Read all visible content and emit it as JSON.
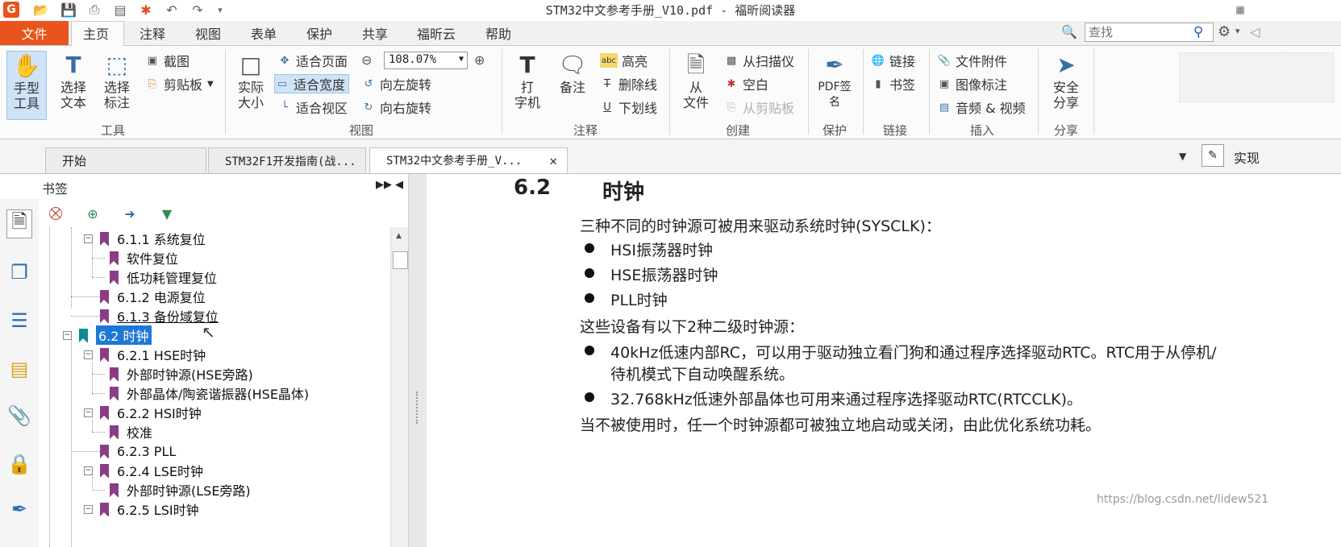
{
  "window": {
    "title": "STM32中文参考手册_V10.pdf - 福昕阅读器"
  },
  "menu": {
    "file": "文件",
    "tabs": [
      "主页",
      "注释",
      "视图",
      "表单",
      "保护",
      "共享",
      "福昕云",
      "帮助"
    ],
    "search_placeholder": "查找"
  },
  "ribbon": {
    "tools": {
      "label": "工具",
      "hand": "手型\n工具",
      "select_text": "选择\n文本",
      "select_annot": "选择\n标注",
      "snapshot": "截图",
      "clipboard": "剪贴板"
    },
    "view": {
      "label": "视图",
      "actual_size": "实际\n大小",
      "fit_page": "适合页面",
      "fit_width": "适合宽度",
      "fit_visible": "适合视区",
      "zoom": "108.07%",
      "rotate_left": "向左旋转",
      "rotate_right": "向右旋转"
    },
    "annotate": {
      "label": "注释",
      "typewriter": "打\n字机",
      "note": "备注",
      "highlight": "高亮",
      "strikeout": "删除线",
      "underline": "下划线"
    },
    "create": {
      "label": "创建",
      "from_file": "从\n文件",
      "from_scanner": "从扫描仪",
      "blank": "空白",
      "from_clipboard": "从剪贴板"
    },
    "protect": {
      "label": "保护",
      "pdf_sign": "PDF签\n名"
    },
    "links": {
      "label": "链接",
      "link": "链接",
      "bookmark": "书签"
    },
    "insert": {
      "label": "插入",
      "file_attachment": "文件附件",
      "image_annotation": "图像标注",
      "audio_video": "音频 & 视频"
    },
    "share": {
      "label": "分享",
      "secure_share": "安全\n分享"
    }
  },
  "doc_tabs": {
    "tabs": [
      "开始",
      "STM32F1开发指南(战...",
      "STM32中文参考手册_V..."
    ],
    "right_action": "实现"
  },
  "bookmarks": {
    "title": "书签",
    "tree": [
      {
        "text": "6.1.1 系统复位"
      },
      {
        "text": "软件复位"
      },
      {
        "text": "低功耗管理复位"
      },
      {
        "text": "6.1.2 电源复位"
      },
      {
        "text": "6.1.3 备份域复位"
      },
      {
        "text": "6.2 时钟"
      },
      {
        "text": "6.2.1 HSE时钟"
      },
      {
        "text": "外部时钟源(HSE旁路)"
      },
      {
        "text": "外部晶体/陶瓷谐振器(HSE晶体)"
      },
      {
        "text": "6.2.2 HSI时钟"
      },
      {
        "text": "校准"
      },
      {
        "text": "6.2.3 PLL"
      },
      {
        "text": "6.2.4 LSE时钟"
      },
      {
        "text": "外部时钟源(LSE旁路)"
      },
      {
        "text": "6.2.5 LSI时钟"
      }
    ]
  },
  "document": {
    "section_number": "6.2",
    "section_title": "时钟",
    "intro": "三种不同的时钟源可被用来驱动系统时钟(SYSCLK)：",
    "bullets1": [
      "HSI振荡器时钟",
      "HSE振荡器时钟",
      "PLL时钟"
    ],
    "secondary_intro": "这些设备有以下2种二级时钟源：",
    "bullet_rc_line1": "40kHz低速内部RC，可以用于驱动独立看门狗和通过程序选择驱动RTC。RTC用于从停机/",
    "bullet_rc_line2": "待机模式下自动唤醒系统。",
    "bullet_lse": "32.768kHz低速外部晶体也可用来通过程序选择驱动RTC(RTCCLK)。",
    "closing": "当不被使用时，任一个时钟源都可被独立地启动或关闭，由此优化系统功耗。"
  },
  "watermark": "https://blog.csdn.net/lidew521"
}
